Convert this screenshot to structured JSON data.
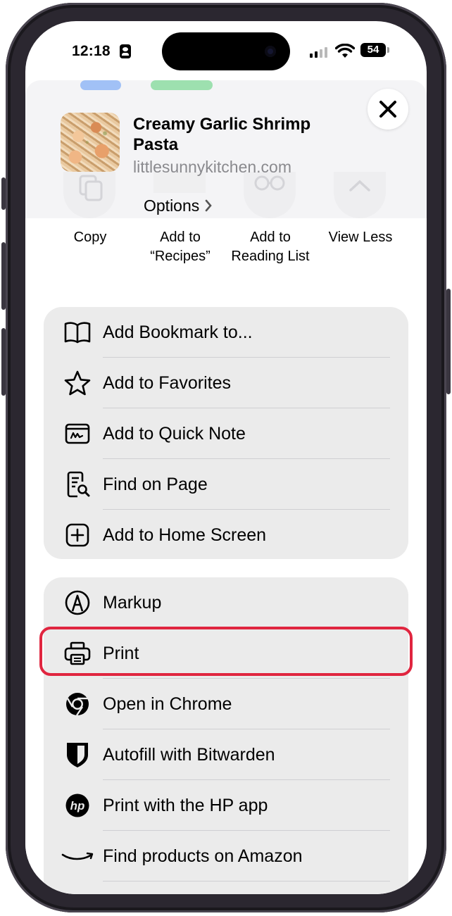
{
  "status_bar": {
    "time": "12:18",
    "battery": "54"
  },
  "share_sheet": {
    "title": "Creamy Garlic Shrimp Pasta",
    "domain": "littlesunnykitchen.com",
    "options_label": "Options",
    "actions": [
      {
        "label": "Copy",
        "icon": "copy-icon"
      },
      {
        "label": "Add to “Recipes”",
        "icon": "notes-icon"
      },
      {
        "label": "Add to Reading List",
        "icon": "glasses-icon"
      },
      {
        "label": "View Less",
        "icon": "chevron-up-icon"
      }
    ],
    "group1": [
      {
        "label": "Add Bookmark to...",
        "icon": "book-icon"
      },
      {
        "label": "Add to Favorites",
        "icon": "star-icon"
      },
      {
        "label": "Add to Quick Note",
        "icon": "quick-note-icon"
      },
      {
        "label": "Find on Page",
        "icon": "find-on-page-icon"
      },
      {
        "label": "Add to Home Screen",
        "icon": "add-square-icon"
      }
    ],
    "group2": [
      {
        "label": "Markup",
        "icon": "markup-icon"
      },
      {
        "label": "Print",
        "icon": "printer-icon",
        "highlighted": true
      },
      {
        "label": "Open in Chrome",
        "icon": "chrome-icon"
      },
      {
        "label": "Autofill with Bitwarden",
        "icon": "bitwarden-icon"
      },
      {
        "label": "Print with the HP app",
        "icon": "hp-icon"
      },
      {
        "label": "Find products on Amazon",
        "icon": "amazon-icon"
      }
    ]
  },
  "colors": {
    "highlight": "#e0253f",
    "group_bg": "#ebebeb",
    "header_bg": "#f4f4f6"
  }
}
